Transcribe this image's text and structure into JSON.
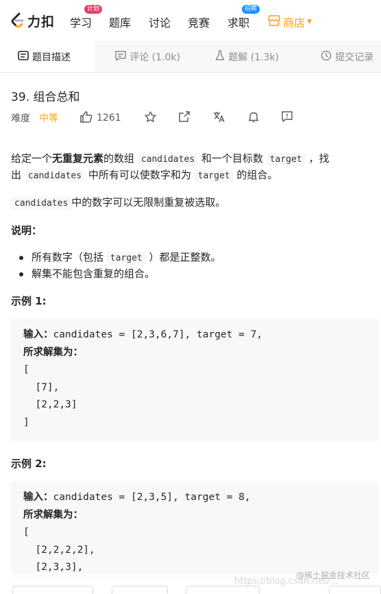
{
  "nav": {
    "logo_text": "力扣",
    "items": [
      {
        "label": "学习",
        "badge": "计划"
      },
      {
        "label": "题库"
      },
      {
        "label": "讨论"
      },
      {
        "label": "竞赛"
      },
      {
        "label": "求职",
        "badge": "招聘"
      }
    ],
    "store_label": "商店"
  },
  "tabs": [
    {
      "label": "题目描述",
      "icon": "description-icon",
      "active": true
    },
    {
      "label": "评论 (1.0k)",
      "icon": "comment-icon"
    },
    {
      "label": "题解 (1.3k)",
      "icon": "flask-icon"
    },
    {
      "label": "提交记录",
      "icon": "clock-icon"
    }
  ],
  "problem": {
    "title": "39. 组合总和",
    "difficulty_label": "难度",
    "difficulty": "中等",
    "likes": "1261"
  },
  "content": {
    "p1_a": "给定一个",
    "p1_bold": "无重复元素",
    "p1_b": "的数组",
    "code_candidates": "candidates",
    "p1_c": "和一个目标数",
    "code_target": "target",
    "p1_d": "，找",
    "p1_e": "出",
    "p1_f": "中所有可以使数字和为",
    "p1_g": "的组合。",
    "p2": "中的数字可以无限制重复被选取。",
    "note_heading": "说明：",
    "li1_a": "所有数字（包括",
    "li1_b": "）都是正整数。",
    "li2": "解集不能包含重复的组合。",
    "example1_heading": "示例 1:",
    "example2_heading": "示例 2:",
    "input_label": "输入：",
    "output_label": "所求解集为：",
    "ex1_input": "candidates = [2,3,6,7], target = 7,",
    "ex1_lines": "[\n  [7],\n  [2,2,3]\n]",
    "ex2_input": "candidates = [2,3,5], target = 8,",
    "ex2_lines": "[\n  [2,2,2,2],\n  [2,3,3],"
  },
  "watermark": "@稀土掘金技术社区",
  "watermark_faint": "https://blog.csdn.net/...",
  "colors": {
    "accent": "#ffa116",
    "badge_red": "#e0436a",
    "badge_blue": "#1a90ff"
  }
}
